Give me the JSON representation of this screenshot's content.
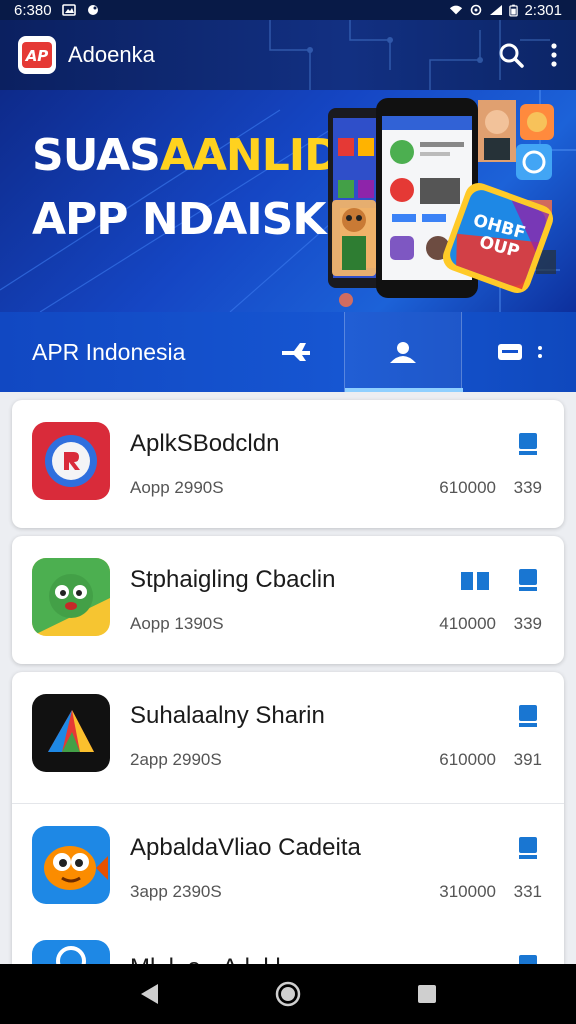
{
  "status_bar": {
    "time_left": "6:380",
    "time_right": "2:301"
  },
  "app_bar": {
    "logo_text": "AP",
    "title": "Adoenka"
  },
  "hero": {
    "line1_white": "SUAS",
    "line1_yellow": "AANLIDA",
    "line2": "APP NDAISK",
    "badge_text": "OHBF OUP"
  },
  "tabs": {
    "label": "APR Indonesia"
  },
  "apps": [
    {
      "name": "AplkSBodcldn",
      "sub": "Aopp 2990S",
      "size": "610000",
      "count": "339",
      "icon": "record-app-icon"
    },
    {
      "name": "Stphaigling Cbaclin",
      "sub": "Aopp 1390S",
      "size": "410000",
      "count": "339",
      "icon": "green-monster-app-icon"
    },
    {
      "name": "Suhalaalny Sharin",
      "sub": "2app 2990S",
      "size": "610000",
      "count": "391",
      "icon": "triangle-app-icon"
    },
    {
      "name": "ApbaldaVliao Cadeita",
      "sub": "3app 2390S",
      "size": "310000",
      "count": "331",
      "icon": "fish-app-icon"
    },
    {
      "name": "Ml..l..e..-A.l..l.l",
      "sub": "",
      "size": "",
      "count": "",
      "icon": "blue-circle-app-icon"
    }
  ],
  "colors": {
    "primary": "#1352cf",
    "accent": "#ffd21f",
    "download": "#1976d2"
  }
}
